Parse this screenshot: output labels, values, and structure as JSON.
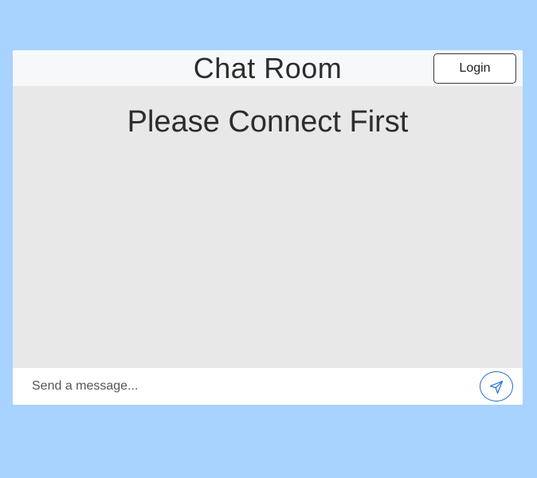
{
  "header": {
    "title": "Chat Room",
    "login_label": "Login"
  },
  "messages": {
    "status_text": "Please Connect First"
  },
  "composer": {
    "placeholder": "Send a message...",
    "value": "",
    "send_icon": "send-icon"
  },
  "colors": {
    "page_background": "#a8d2ff",
    "header_background": "#f7f8fa",
    "message_area_background": "#e8e8e8",
    "send_accent": "#1a6fd6"
  }
}
